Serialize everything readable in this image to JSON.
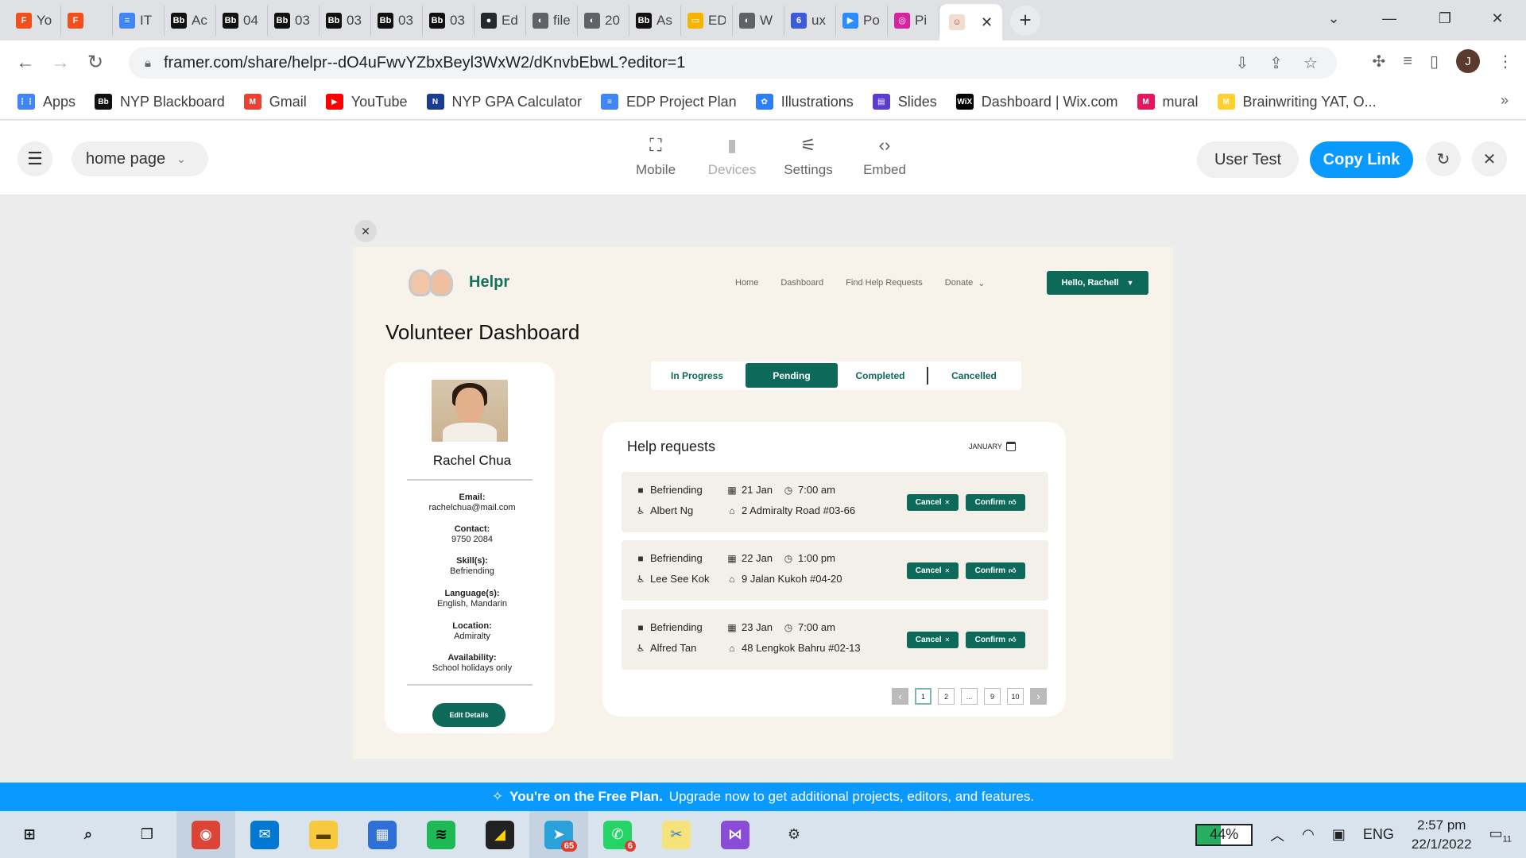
{
  "browser": {
    "tabs": [
      {
        "label": "Yo",
        "icon": "figma-icon",
        "color": "#f24e1e",
        "glyph": "F"
      },
      {
        "label": "",
        "icon": "figma-play-icon",
        "color": "#f24e1e",
        "glyph": "F"
      },
      {
        "label": "IT",
        "icon": "google-docs-icon",
        "color": "#4285f4",
        "glyph": "≡"
      },
      {
        "label": "Ac",
        "icon": "blackboard-icon",
        "color": "#111111",
        "glyph": "Bb"
      },
      {
        "label": "04",
        "icon": "blackboard-icon",
        "color": "#111111",
        "glyph": "Bb"
      },
      {
        "label": "03",
        "icon": "blackboard-icon",
        "color": "#111111",
        "glyph": "Bb"
      },
      {
        "label": "03",
        "icon": "blackboard-icon",
        "color": "#111111",
        "glyph": "Bb"
      },
      {
        "label": "03",
        "icon": "blackboard-icon",
        "color": "#111111",
        "glyph": "Bb"
      },
      {
        "label": "03",
        "icon": "blackboard-icon",
        "color": "#111111",
        "glyph": "Bb"
      },
      {
        "label": "Ed",
        "icon": "github-icon",
        "color": "#24292e",
        "glyph": "●"
      },
      {
        "label": "file",
        "icon": "globe-icon",
        "color": "#5f6368",
        "glyph": "◐"
      },
      {
        "label": "20",
        "icon": "globe-icon",
        "color": "#5f6368",
        "glyph": "◐"
      },
      {
        "label": "As",
        "icon": "blackboard-icon",
        "color": "#111111",
        "glyph": "Bb"
      },
      {
        "label": "ED",
        "icon": "google-slides-icon",
        "color": "#f4b400",
        "glyph": "▭"
      },
      {
        "label": "W",
        "icon": "globe-icon",
        "color": "#5f6368",
        "glyph": "◐"
      },
      {
        "label": "ux",
        "icon": "notification-icon",
        "color": "#3b5bdb",
        "glyph": "6"
      },
      {
        "label": "Po",
        "icon": "zoom-icon",
        "color": "#2d8cff",
        "glyph": "▶"
      },
      {
        "label": "Pi",
        "icon": "instagram-icon",
        "color": "#d6249f",
        "glyph": "◎"
      }
    ],
    "active_tab_icon": "helpr-icon",
    "url": "framer.com/share/helpr--dO4uFwvYZbxBeyl3WxW2/dKnvbEbwL?editor=1",
    "profile_initial": "J",
    "bookmarks": [
      {
        "label": "Apps",
        "icon": "apps-grid-icon",
        "color": "#4285f4",
        "glyph": "⋮⋮"
      },
      {
        "label": "NYP Blackboard",
        "icon": "blackboard-icon",
        "color": "#111111",
        "glyph": "Bb"
      },
      {
        "label": "Gmail",
        "icon": "gmail-icon",
        "color": "#ea4335",
        "glyph": "M"
      },
      {
        "label": "YouTube",
        "icon": "youtube-icon",
        "color": "#ff0000",
        "glyph": "▶"
      },
      {
        "label": "NYP GPA Calculator",
        "icon": "nyp-icon",
        "color": "#1a3d8f",
        "glyph": "N"
      },
      {
        "label": "EDP Project Plan",
        "icon": "google-docs-icon",
        "color": "#4285f4",
        "glyph": "≡"
      },
      {
        "label": "Illustrations",
        "icon": "illustrations-icon",
        "color": "#2d7ff9",
        "glyph": "✿"
      },
      {
        "label": "Slides",
        "icon": "slides-icon",
        "color": "#5b3ccf",
        "glyph": "▤"
      },
      {
        "label": "Dashboard | Wix.com",
        "icon": "wix-icon",
        "color": "#000000",
        "glyph": "WiX"
      },
      {
        "label": "mural",
        "icon": "mural-icon",
        "color": "#e8175d",
        "glyph": "M"
      },
      {
        "label": "Brainwriting YAT, O...",
        "icon": "miro-icon",
        "color": "#ffd02f",
        "glyph": "M"
      }
    ],
    "bookmarks_more": "»"
  },
  "framer": {
    "page_select": "home page",
    "tools": [
      {
        "label": "Mobile",
        "icon": "mobile-frame-icon",
        "glyph": "⛶",
        "disabled": false
      },
      {
        "label": "Devices",
        "icon": "devices-icon",
        "glyph": "▮",
        "disabled": true
      },
      {
        "label": "Settings",
        "icon": "sliders-icon",
        "glyph": "⚟",
        "disabled": false
      },
      {
        "label": "Embed",
        "icon": "code-icon",
        "glyph": "‹›",
        "disabled": false
      }
    ],
    "user_test": "User Test",
    "copy_link": "Copy Link",
    "banner_bold": "You're on the Free Plan.",
    "banner_text": "Upgrade now to get additional projects, editors, and features."
  },
  "app": {
    "brand": "Helpr",
    "nav": [
      "Home",
      "Dashboard",
      "Find Help Requests",
      "Donate"
    ],
    "user_button": "Hello, Rachell",
    "page_title": "Volunteer Dashboard",
    "profile": {
      "name": "Rachel Chua",
      "fields": [
        {
          "label": "Email:",
          "value": "rachelchua@mail.com"
        },
        {
          "label": "Contact:",
          "value": "9750 2084"
        },
        {
          "label": "Skill(s):",
          "value": "Befriending"
        },
        {
          "label": "Language(s):",
          "value": "English, Mandarin"
        },
        {
          "label": "Location:",
          "value": "Admiralty"
        },
        {
          "label": "Availability:",
          "value": "School holidays only"
        }
      ],
      "edit_button": "Edit Details"
    },
    "status_tabs": [
      "In Progress",
      "Pending",
      "Completed",
      "Cancelled"
    ],
    "active_status": "Pending",
    "requests_title": "Help requests",
    "month": "JANUARY",
    "requests": [
      {
        "type": "Befriending",
        "date": "21 Jan",
        "time": "7:00 am",
        "person": "Albert Ng",
        "address": "2 Admiralty Road #03-66"
      },
      {
        "type": "Befriending",
        "date": "22 Jan",
        "time": "1:00 pm",
        "person": "Lee See Kok",
        "address": "9 Jalan Kukoh #04-20"
      },
      {
        "type": "Befriending",
        "date": "23 Jan",
        "time": "7:00 am",
        "person": "Alfred Tan",
        "address": "48 Lengkok Bahru #02-13"
      }
    ],
    "cancel_label": "Cancel",
    "confirm_label": "Confirm",
    "pages": [
      "1",
      "2",
      "...",
      "9",
      "10"
    ],
    "current_page": "1",
    "accent_color": "#0d6a5a"
  },
  "taskbar": {
    "apps": [
      {
        "name": "windows-start-icon",
        "glyph": "⊞",
        "color": "#1b1b1b",
        "bg": "transparent"
      },
      {
        "name": "search-icon",
        "glyph": "⌕",
        "color": "#1b1b1b",
        "bg": "transparent"
      },
      {
        "name": "task-view-icon",
        "glyph": "❐",
        "color": "#1b1b1b",
        "bg": "transparent"
      },
      {
        "name": "chrome-icon",
        "glyph": "◉",
        "color": "#ffffff",
        "bg": "#db4437",
        "active": true
      },
      {
        "name": "mail-icon",
        "glyph": "✉",
        "color": "#ffffff",
        "bg": "#0078d4"
      },
      {
        "name": "file-explorer-icon",
        "glyph": "▬",
        "color": "#5a3d00",
        "bg": "#f8c93e"
      },
      {
        "name": "microsoft-store-icon",
        "glyph": "▦",
        "color": "#ffffff",
        "bg": "#2e6fd8"
      },
      {
        "name": "spotify-icon",
        "glyph": "≋",
        "color": "#000000",
        "bg": "#1db954"
      },
      {
        "name": "sticky-notes-icon",
        "glyph": "◢",
        "color": "#ffd400",
        "bg": "#222222"
      },
      {
        "name": "telegram-icon",
        "glyph": "➤",
        "color": "#ffffff",
        "bg": "#2aa1da",
        "badge": "65",
        "active": true
      },
      {
        "name": "whatsapp-icon",
        "glyph": "✆",
        "color": "#ffffff",
        "bg": "#25d366",
        "badge": "6"
      },
      {
        "name": "snipping-tool-icon",
        "glyph": "✂",
        "color": "#2b7bd6",
        "bg": "#f6e27a"
      },
      {
        "name": "visual-studio-icon",
        "glyph": "⋈",
        "color": "#ffffff",
        "bg": "#8a4bd6"
      },
      {
        "name": "settings-icon",
        "glyph": "⚙",
        "color": "#333333",
        "bg": "transparent"
      }
    ],
    "battery": "44%",
    "language": "ENG",
    "time": "2:57 pm",
    "date": "22/1/2022",
    "notification_count": "11"
  }
}
